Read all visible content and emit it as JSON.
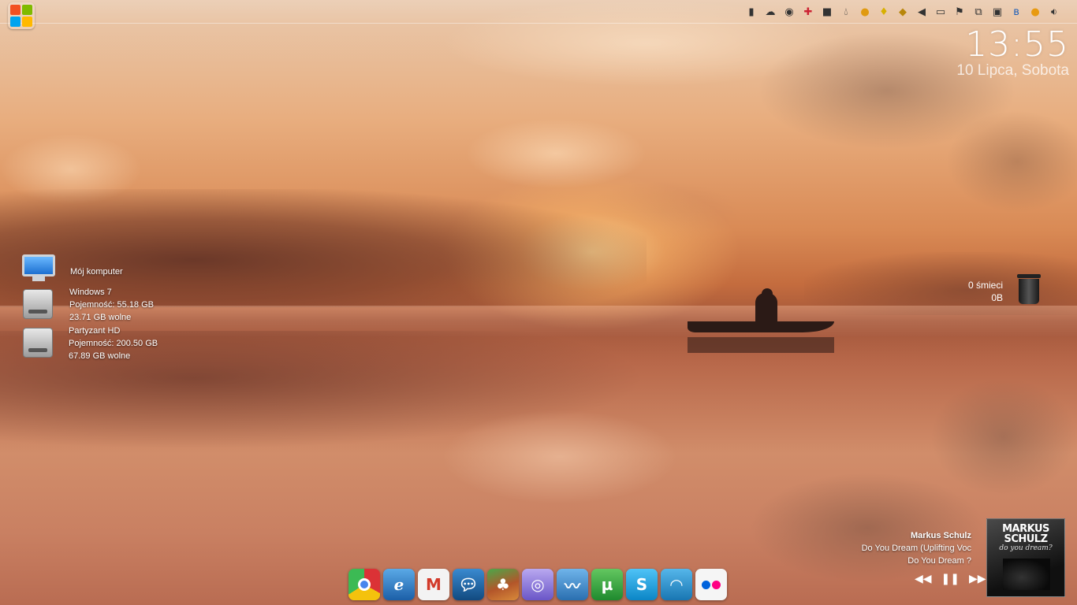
{
  "clock": {
    "time": "13:55",
    "date": "10 Lipca, Sobota"
  },
  "drives": {
    "computer": {
      "label": "Mój komputer"
    },
    "items": [
      {
        "name": "Windows 7",
        "capacity": "Pojemność: 55.18 GB",
        "free": "23.71 GB wolne"
      },
      {
        "name": "Partyzant HD",
        "capacity": "Pojemność: 200.50 GB",
        "free": "67.89 GB wolne"
      }
    ]
  },
  "recycle_bin": {
    "count": "0 śmieci",
    "size": "0B"
  },
  "player": {
    "artist": "Markus Schulz",
    "track": "Do You Dream (Uplifting Voc",
    "album": "Do You Dream ?",
    "album_art_title": "MARKUS SCHULZ",
    "album_art_subtitle": "do you dream?"
  },
  "tray_icons": [
    "battery-icon",
    "network-icon",
    "disc-icon",
    "antivirus-icon",
    "display-icon",
    "water-drop-icon",
    "sun-icon",
    "lightbulb-icon",
    "tag-icon",
    "speaker-icon",
    "monitor-icon",
    "flag-icon",
    "usb-icon",
    "window-icon",
    "bluetooth-icon",
    "orange-menu-icon",
    "volume-icon"
  ],
  "dock": [
    {
      "name": "chrome",
      "color": "#e8b93a"
    },
    {
      "name": "internet-explorer",
      "color": "#2f7fc2"
    },
    {
      "name": "gmail",
      "color": "#f3f3f3"
    },
    {
      "name": "chat",
      "color": "#1f6aa3"
    },
    {
      "name": "game",
      "color": "#b3562a"
    },
    {
      "name": "media-player",
      "color": "#8c78d8"
    },
    {
      "name": "wings-app",
      "color": "#3b83c4"
    },
    {
      "name": "utorrent",
      "color": "#3aa34a"
    },
    {
      "name": "skype",
      "color": "#14a3e0"
    },
    {
      "name": "wifi",
      "color": "#2a8fc9"
    },
    {
      "name": "flickr",
      "color": "#f5f5f5"
    }
  ],
  "colors": {
    "sky_top": "#e9c9ad",
    "sunset": "#d98a55",
    "water": "#b8684a"
  }
}
